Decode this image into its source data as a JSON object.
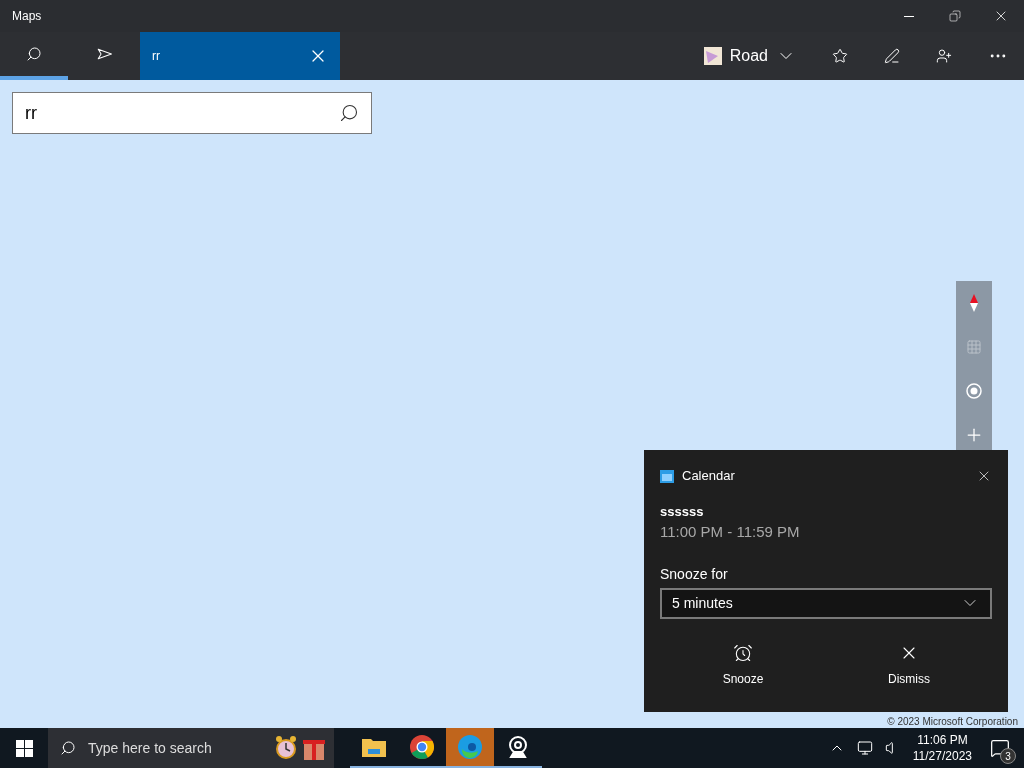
{
  "window": {
    "title": "Maps"
  },
  "toolbar": {
    "tabs": [
      {
        "kind": "search",
        "selected": true
      },
      {
        "kind": "directions",
        "selected": false
      }
    ],
    "result_tab": {
      "label": "rr"
    },
    "map_style": {
      "label": "Road"
    }
  },
  "search": {
    "value": "rr"
  },
  "map_controls": [
    {
      "kind": "compass",
      "disabled": false
    },
    {
      "kind": "tilt",
      "disabled": true
    },
    {
      "kind": "locate",
      "disabled": false
    },
    {
      "kind": "zoom_in",
      "disabled": false
    }
  ],
  "copyright": "© 2023 Microsoft Corporation",
  "notification": {
    "app": "Calendar",
    "title": "ssssss",
    "time": "11:00 PM - 11:59 PM",
    "snooze_label": "Snooze for",
    "snooze_value": "5 minutes",
    "actions": [
      {
        "kind": "snooze",
        "label": "Snooze"
      },
      {
        "kind": "dismiss",
        "label": "Dismiss"
      }
    ]
  },
  "taskbar": {
    "search_placeholder": "Type here to search",
    "apps": [
      {
        "kind": "explorer",
        "active": false
      },
      {
        "kind": "chrome",
        "active": false
      },
      {
        "kind": "edge",
        "active": true
      },
      {
        "kind": "camera",
        "active": false
      }
    ],
    "time": "11:06 PM",
    "date": "11/27/2023",
    "notification_count": "3"
  }
}
